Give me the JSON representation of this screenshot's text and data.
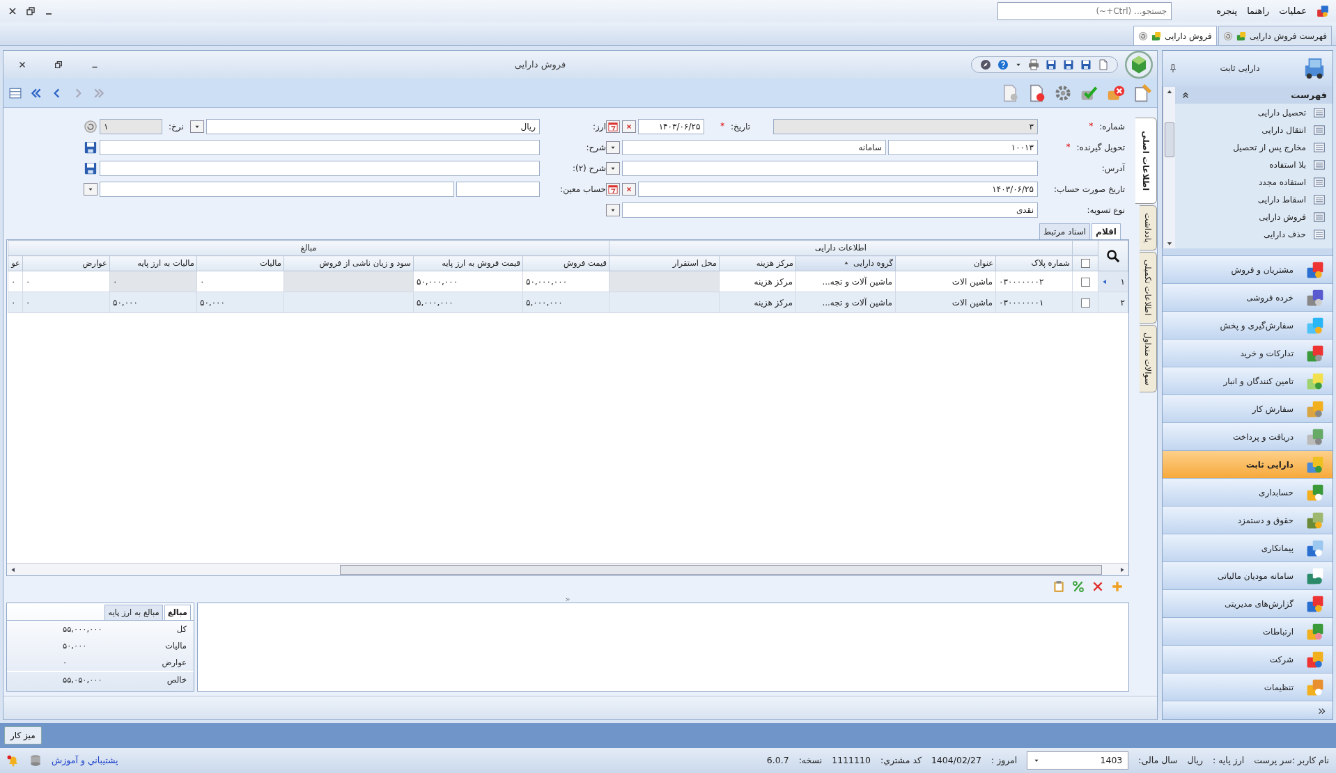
{
  "menu_bar": {
    "items": [
      "عملیات",
      "راهنما",
      "پنجره"
    ],
    "search": {
      "placeholder": "جستجو... (Ctrl+~)"
    }
  },
  "document_tabs": [
    {
      "label": "فهرست فروش دارایی",
      "selected": false
    },
    {
      "label": "فروش دارایی",
      "selected": true
    }
  ],
  "form_window": {
    "title": "فروش دارایی"
  },
  "form": {
    "number": {
      "label": "شماره:",
      "required": true,
      "required_mark": "*",
      "value": "۳",
      "disabled": true
    },
    "date": {
      "label": "تاریخ:",
      "required": true,
      "required_mark": "*",
      "value": "۱۴۰۳/۰۶/۲۵"
    },
    "receiver": {
      "label": "تحویل گیرنده:",
      "required": true,
      "required_mark": "*",
      "code": "۱۰۰۱۳",
      "name": "سامانه"
    },
    "address": {
      "label": "آدرس:"
    },
    "invoice_date": {
      "label": "تاریخ صورت حساب:",
      "value": "۱۴۰۳/۰۶/۲۵"
    },
    "settlement": {
      "label": "نوع تسویه:",
      "value": "نقدی"
    },
    "currency": {
      "label": "ارز:",
      "value": "ریال"
    },
    "rate": {
      "label": "نرخ:",
      "value": "۱",
      "disabled": true
    },
    "description": {
      "label": "شرح:"
    },
    "description2": {
      "label": "شرح (۲):"
    },
    "account": {
      "label": "حساب معین:"
    }
  },
  "side_tabs": [
    {
      "label": "اطلاعات اصلی",
      "selected": true
    },
    {
      "label": "یادداشت",
      "selected": false
    },
    {
      "label": "اطلاعات تکمیلی",
      "selected": false
    },
    {
      "label": "سوالات متداول",
      "selected": false
    }
  ],
  "grid_tabs": [
    {
      "label": "اقلام",
      "selected": true
    },
    {
      "label": "اسناد مرتبط",
      "selected": false
    }
  ],
  "grid": {
    "select_all_checked": false,
    "groups": [
      {
        "label": "اطلاعات دارایی",
        "columns": [
          {
            "label": "شماره پلاک",
            "readonly": false,
            "sorted": false
          },
          {
            "label": "عنوان",
            "readonly": false,
            "sorted": false
          },
          {
            "label": "گروه دارایی",
            "readonly": false,
            "sorted": true
          },
          {
            "label": "مرکز هزینه",
            "readonly": false,
            "sorted": false
          },
          {
            "label": "محل استقرار",
            "readonly": true,
            "sorted": false
          }
        ]
      },
      {
        "label": "مبالغ",
        "columns": [
          {
            "label": "قیمت فروش",
            "readonly": false,
            "sorted": false
          },
          {
            "label": "قیمت فروش به ارز پایه",
            "readonly": false,
            "sorted": false
          },
          {
            "label": "سود و زیان ناشی از فروش",
            "readonly": true,
            "sorted": false
          },
          {
            "label": "مالیات",
            "readonly": false,
            "sorted": false
          },
          {
            "label": "مالیات به ارز پایه",
            "readonly": true,
            "sorted": false
          },
          {
            "label": "عوارض",
            "readonly": false,
            "sorted": false
          },
          {
            "label": "عو",
            "readonly": false,
            "sorted": false
          }
        ]
      }
    ],
    "rows": [
      {
        "number": "۱",
        "selected": true,
        "checked": false,
        "cells": [
          "۰۳۰۰۰۰۰۰۰۲",
          "ماشین الات",
          "ماشین آلات و تجه...",
          "مرکز هزینه",
          "",
          "۵۰,۰۰۰,۰۰۰",
          "۵۰,۰۰۰,۰۰۰",
          "",
          "۰",
          "۰",
          "۰",
          "۰"
        ]
      },
      {
        "number": "۲",
        "selected": false,
        "checked": false,
        "cells": [
          "۰۳۰۰۰۰۰۰۰۱",
          "ماشین الات",
          "ماشین آلات و تجه...",
          "مرکز هزینه",
          "",
          "۵,۰۰۰,۰۰۰",
          "۵,۰۰۰,۰۰۰",
          "",
          "۵۰,۰۰۰",
          "۵۰,۰۰۰",
          "۰",
          "۰"
        ]
      }
    ]
  },
  "summary": {
    "tabs": [
      {
        "label": "مبالغ",
        "selected": true
      },
      {
        "label": "مبالغ به ارز پایه",
        "selected": false
      }
    ],
    "rows": [
      {
        "label": "کل",
        "value": "۵۵,۰۰۰,۰۰۰"
      },
      {
        "label": "مالیات",
        "value": "۵۰,۰۰۰"
      },
      {
        "label": "عوارض",
        "value": "۰"
      },
      {
        "label": "خالص",
        "value": "۵۵,۰۵۰,۰۰۰"
      }
    ]
  },
  "sidebar": {
    "title": "دارایی ثابت",
    "list_title": "فهرست",
    "list_items": [
      "تحصیل دارایی",
      "انتقال دارایی",
      "مخارج پس از تحصیل",
      "بلا استفاده",
      "استفاده مجدد",
      "اسقاط دارایی",
      "فروش دارایی",
      "حذف دارایی"
    ],
    "modules": [
      {
        "label": "مشتریان و فروش",
        "selected": false
      },
      {
        "label": "خرده فروشی",
        "selected": false
      },
      {
        "label": "سفارش‌گیری و پخش",
        "selected": false
      },
      {
        "label": "تدارکات و خرید",
        "selected": false
      },
      {
        "label": "تامین کنندگان و انبار",
        "selected": false
      },
      {
        "label": "سفارش کار",
        "selected": false
      },
      {
        "label": "دریافت و پرداخت",
        "selected": false
      },
      {
        "label": "دارایی ثابت",
        "selected": true
      },
      {
        "label": "حسابداری",
        "selected": false
      },
      {
        "label": "حقوق و دستمزد",
        "selected": false
      },
      {
        "label": "پیمانکاری",
        "selected": false
      },
      {
        "label": "سامانه مودیان مالیاتی",
        "selected": false
      },
      {
        "label": "گزارش‌های مدیریتی",
        "selected": false
      },
      {
        "label": "ارتباطات",
        "selected": false
      },
      {
        "label": "شرکت",
        "selected": false
      },
      {
        "label": "تنظیمات",
        "selected": false
      }
    ]
  },
  "taskbar": {
    "button": "میز کار"
  },
  "status_bar": {
    "user": "نام کاربر :سر پرست",
    "base_currency_label": "ارز پایه :",
    "base_currency": "ریال",
    "fiscal_year_label": "سال مالی:",
    "fiscal_year": "1403",
    "today_label": "امروز :",
    "today": "1404/02/27",
    "customer_code_label": "کد مشتري:",
    "customer_code": "1111110",
    "version_label": "نسخه:",
    "version": "6.0.7",
    "support_link": "پشتيباني و آموزش"
  }
}
